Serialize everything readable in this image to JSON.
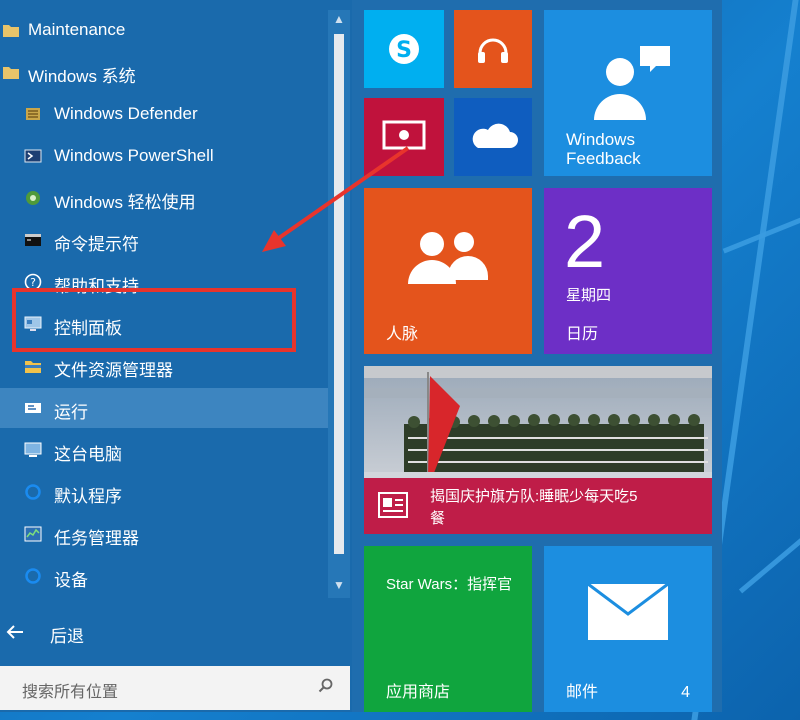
{
  "start_menu": {
    "left_list": [
      {
        "label": "Maintenance",
        "icon": "folder-icon",
        "type": "group"
      },
      {
        "label": "Windows 系统",
        "icon": "folder-icon",
        "type": "group"
      },
      {
        "label": "Windows Defender",
        "icon": "defender-icon",
        "type": "app"
      },
      {
        "label": "Windows PowerShell",
        "icon": "powershell-icon",
        "type": "app"
      },
      {
        "label": "Windows 轻松使用",
        "icon": "ease-of-access-icon",
        "type": "app"
      },
      {
        "label": "命令提示符",
        "icon": "command-prompt-icon",
        "type": "app"
      },
      {
        "label": "帮助和支持",
        "icon": "help-icon",
        "type": "app"
      },
      {
        "label": "控制面板",
        "icon": "control-panel-icon",
        "type": "app",
        "highlighted": true
      },
      {
        "label": "文件资源管理器",
        "icon": "file-explorer-icon",
        "type": "app"
      },
      {
        "label": "运行",
        "icon": "run-icon",
        "type": "app",
        "selected": true
      },
      {
        "label": "这台电脑",
        "icon": "this-pc-icon",
        "type": "app"
      },
      {
        "label": "默认程序",
        "icon": "default-programs-icon",
        "type": "app"
      },
      {
        "label": "任务管理器",
        "icon": "task-manager-icon",
        "type": "app"
      },
      {
        "label": "设备",
        "icon": "devices-icon",
        "type": "app"
      }
    ],
    "back_label": "后退",
    "search_placeholder": "搜索所有位置"
  },
  "tiles": {
    "skype": {
      "icon": "skype-icon",
      "color": "#00aff0"
    },
    "music": {
      "icon": "headphones-icon",
      "color": "#e4541c"
    },
    "video": {
      "icon": "video-icon",
      "color": "#c0123c"
    },
    "onedrive": {
      "icon": "onedrive-icon",
      "color": "#0f5dbf"
    },
    "feedback": {
      "label": "Windows Feedback",
      "icon": "feedback-icon",
      "color": "#1c8ee0"
    },
    "people": {
      "label": "人脉",
      "icon": "people-icon",
      "color": "#e4541c"
    },
    "calendar": {
      "label": "日历",
      "day_number": "2",
      "weekday": "星期四",
      "color": "#6d2fc6"
    },
    "news": {
      "headline": "揭国庆护旗方队:睡眠少每天吃5餐",
      "icon": "news-icon",
      "color": "#bf1d48"
    },
    "store": {
      "title": "Star Wars：指挥官",
      "label": "应用商店",
      "color": "#10a53e"
    },
    "mail": {
      "label": "邮件",
      "count": "4",
      "icon": "mail-icon",
      "color": "#1c8ee0"
    }
  },
  "colors": {
    "highlight_box": "#e8342c",
    "arrow": "#e8342c"
  }
}
